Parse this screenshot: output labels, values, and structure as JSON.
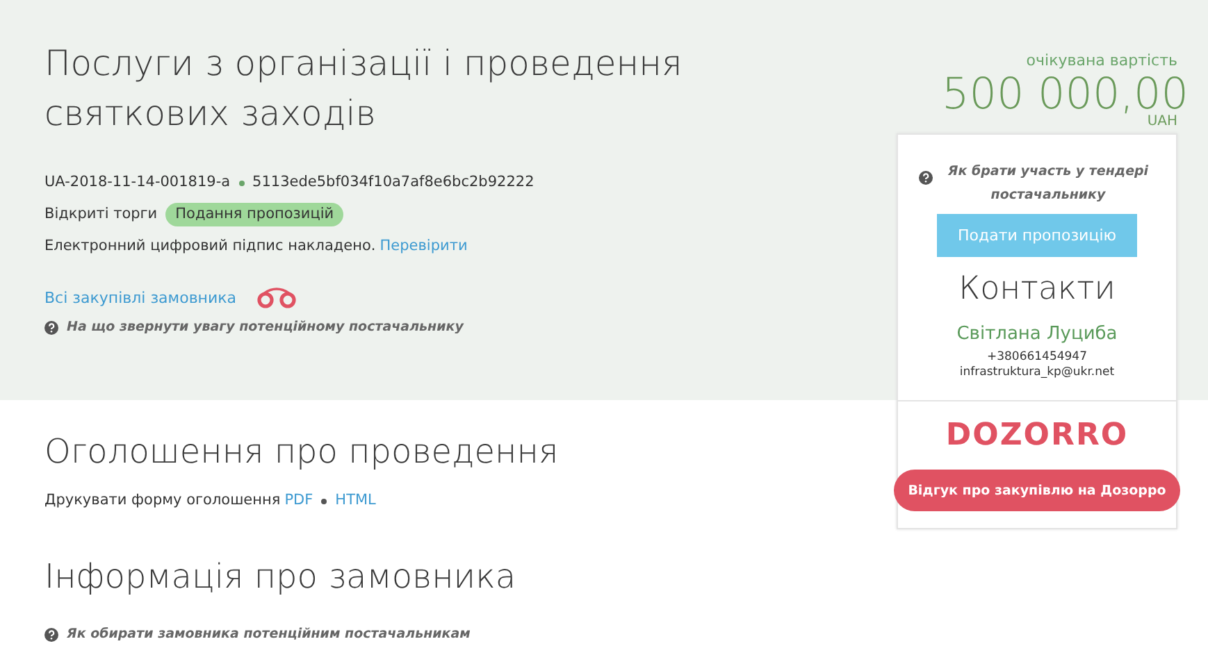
{
  "tender": {
    "title": "Послуги з організації і проведення святкових заходів",
    "id": "UA-2018-11-14-001819-a",
    "hash": "5113ede5bf034f10a7af8e6bc2b92222",
    "procedure": "Відкриті торги",
    "status": "Подання пропозицій",
    "signature": "Електронний цифровий підпис накладено.",
    "signature_link": "Перевірити",
    "buyer_link": "Всі закупівлі замовника",
    "hint": "На що звернути увагу потенційному постачальнику"
  },
  "price": {
    "label": "очікувана вартість",
    "amount": "500 000,00",
    "currency": "UAH"
  },
  "sidebar": {
    "hint": "Як брати участь у тендері постачальнику",
    "submit_button": "Подати пропозицію",
    "contacts_title": "Контакти",
    "contact_name": "Світлана Луциба",
    "phone": "+380661454947",
    "email": "infrastruktura_kp@ukr.net",
    "logo": "DOZORRO",
    "feedback_button": "Відгук про закупівлю на Дозорро"
  },
  "announcement": {
    "title": "Оголошення про проведення",
    "print_label": "Друкувати форму оголошення",
    "links": [
      "PDF",
      "HTML"
    ]
  },
  "buyer_info": {
    "title": "Інформація про замовника",
    "hint": "Як обирати замовника потенційним постачальникам"
  }
}
